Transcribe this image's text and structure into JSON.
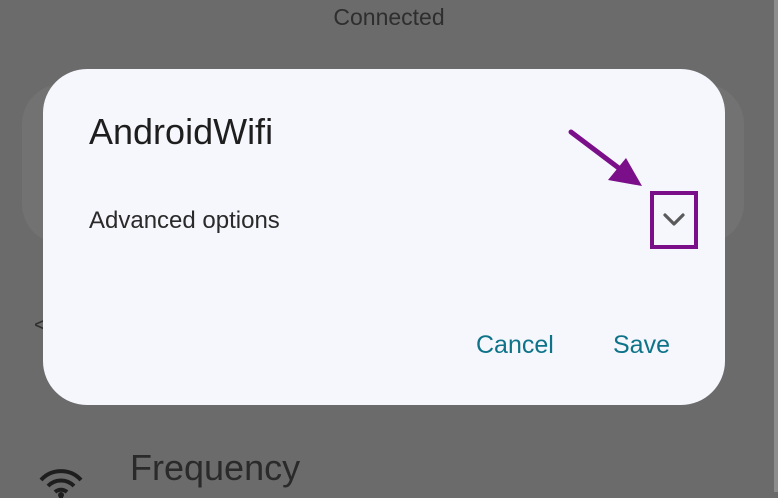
{
  "background": {
    "status_text": "Connected",
    "back_fragment": "<",
    "frequency_label": "Frequency"
  },
  "dialog": {
    "title": "AndroidWifi",
    "advanced_options_label": "Advanced options",
    "cancel_label": "Cancel",
    "save_label": "Save"
  },
  "icons": {
    "expand": "chevron-down-icon",
    "annotation": "arrow-icon",
    "wifi": "wifi-icon"
  },
  "colors": {
    "accent": "#0e7389",
    "highlight": "#7b0f8a",
    "dialog_bg": "#f6f7fc",
    "scrim": "#6b6b6b"
  }
}
